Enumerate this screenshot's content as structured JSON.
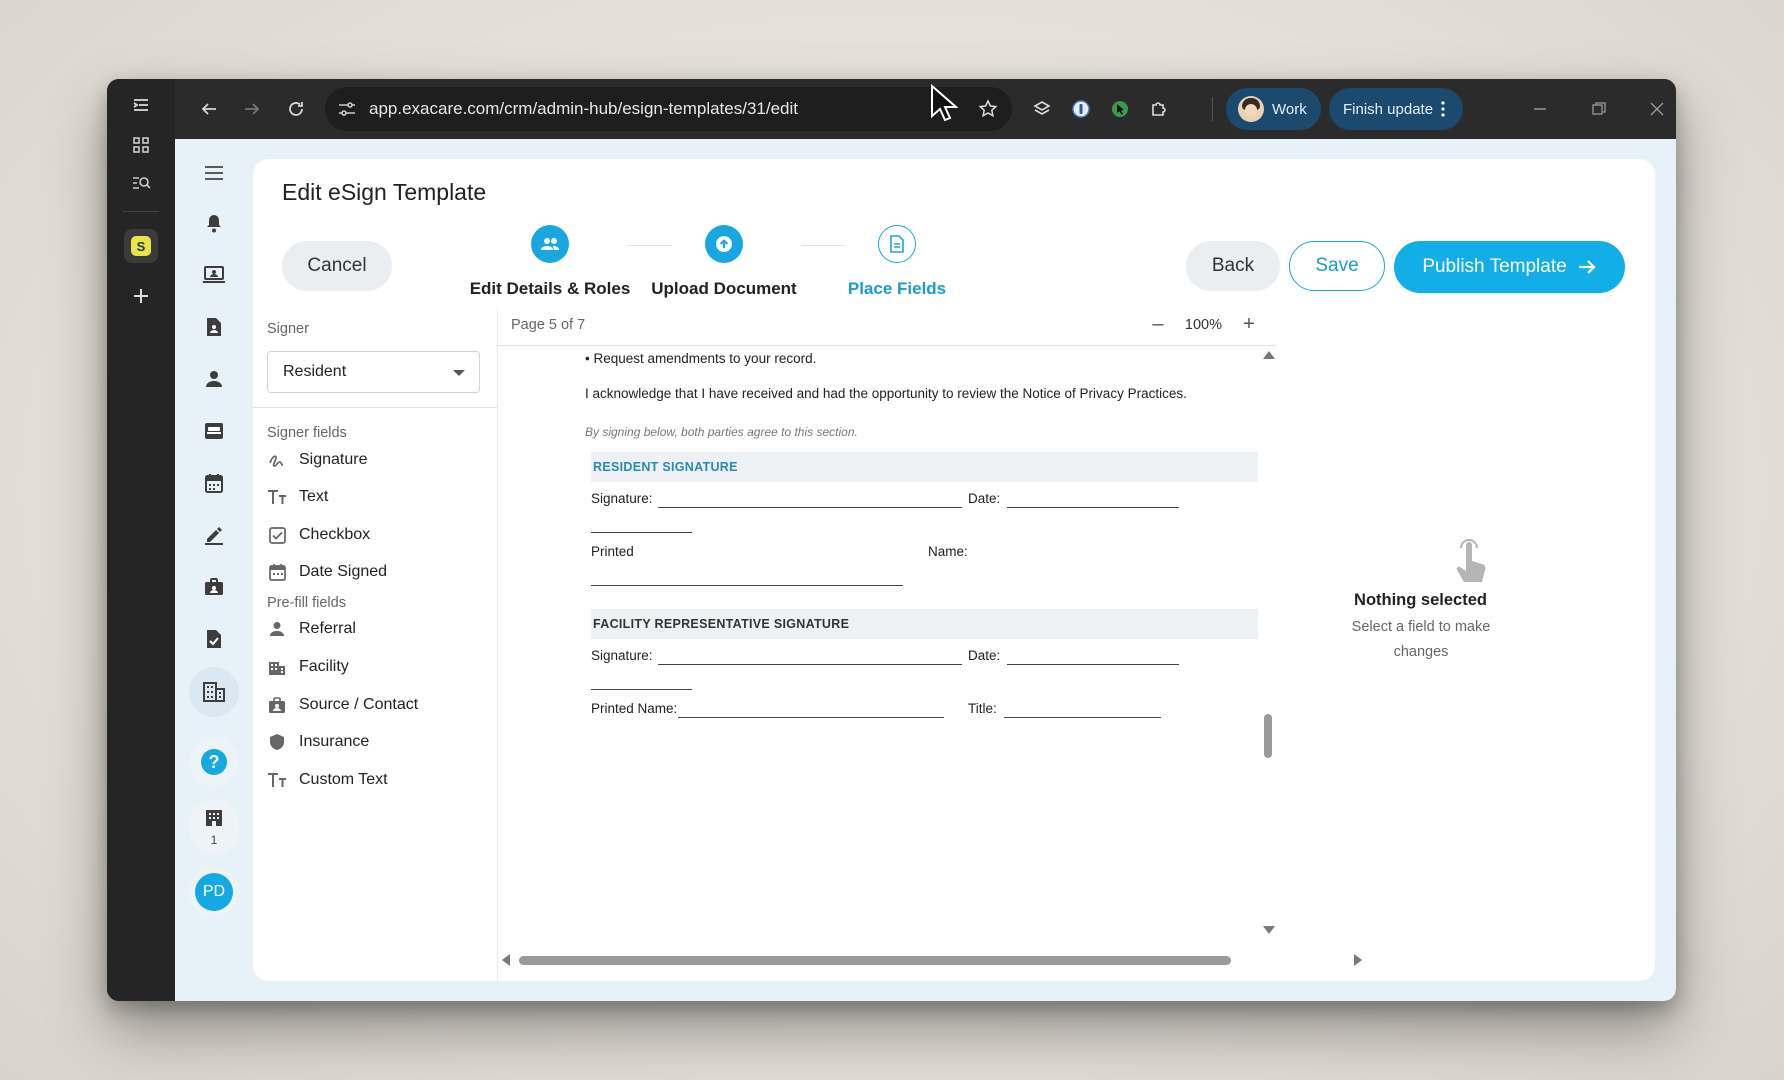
{
  "browser": {
    "url": "app.exacare.com/crm/admin-hub/esign-templates/31/edit",
    "profile_label": "Work",
    "update_label": "Finish update"
  },
  "page": {
    "title": "Edit eSign Template",
    "cancel_label": "Cancel",
    "back_label": "Back",
    "save_label": "Save",
    "publish_label": "Publish Template"
  },
  "steps": [
    {
      "label": "Edit Details & Roles",
      "icon": "people-icon",
      "state": "done"
    },
    {
      "label": "Upload Document",
      "icon": "upload-icon",
      "state": "done"
    },
    {
      "label": "Place Fields",
      "icon": "document-icon",
      "state": "active"
    }
  ],
  "sidebar": {
    "signer_label": "Signer",
    "signer_value": "Resident",
    "signer_fields_label": "Signer fields",
    "signer_fields": [
      {
        "label": "Signature",
        "icon": "signature-icon"
      },
      {
        "label": "Text",
        "icon": "text-icon"
      },
      {
        "label": "Checkbox",
        "icon": "checkbox-icon"
      },
      {
        "label": "Date Signed",
        "icon": "calendar-icon"
      }
    ],
    "prefill_label": "Pre-fill fields",
    "prefill_fields": [
      {
        "label": "Referral",
        "icon": "person-icon"
      },
      {
        "label": "Facility",
        "icon": "building-icon"
      },
      {
        "label": "Source / Contact",
        "icon": "contact-badge-icon"
      },
      {
        "label": "Insurance",
        "icon": "shield-icon"
      },
      {
        "label": "Custom Text",
        "icon": "text-icon"
      }
    ]
  },
  "viewer": {
    "page_indicator": "Page 5 of 7",
    "zoom": "100%",
    "minus": "–",
    "plus": "+"
  },
  "document": {
    "bullet_line": "• Request amendments to your record.",
    "acknowledge": "I acknowledge that I have received and had the opportunity to review the Notice of Privacy Practices.",
    "note": "By signing below, both parties agree to this section.",
    "resident_heading": "RESIDENT SIGNATURE",
    "facility_heading": "FACILITY REPRESENTATIVE SIGNATURE",
    "signature_label": "Signature:",
    "date_label": "Date:",
    "printed_label": "Printed",
    "name_label": "Name:",
    "printed_name_label": "Printed Name:",
    "title_label": "Title:"
  },
  "properties": {
    "empty_title": "Nothing selected",
    "empty_sub": "Select a field to make changes"
  },
  "leftnav": {
    "facility_count": "1",
    "avatar_initials": "PD"
  },
  "colors": {
    "accent": "#12aee8",
    "accent_text": "#1a9bd3",
    "profile_pill": "#1c4a6e"
  }
}
